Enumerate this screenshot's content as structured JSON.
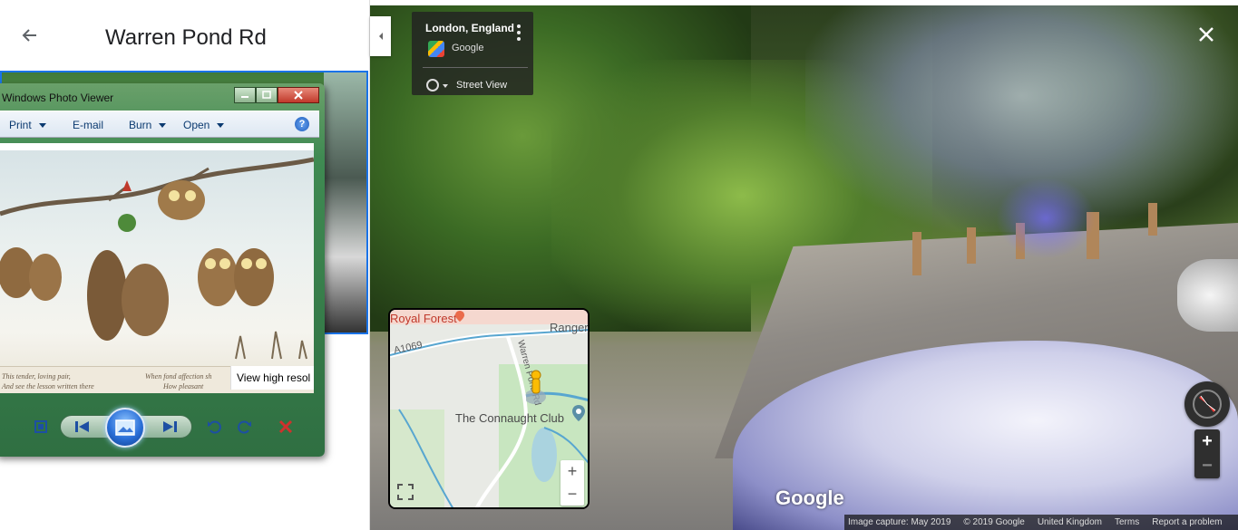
{
  "left_panel": {
    "title": "Warren Pond Rd"
  },
  "photo_viewer": {
    "window_title": "Windows Photo Viewer",
    "menu": {
      "print": "Print",
      "email": "E-mail",
      "burn": "Burn",
      "open": "Open"
    },
    "help": "?",
    "card_lines": [
      "This tender, loving pair,",
      "When fond affection sh",
      "And see the lesson written there",
      "How pleasant"
    ],
    "view_high_res": "View high resol"
  },
  "street_view": {
    "location_title": "London, England",
    "provider": "Google",
    "mode_label": "Street View",
    "google_logo": "Google",
    "footer": {
      "capture": "Image capture: May 2019",
      "copyright": "© 2019 Google",
      "region": "United Kingdom",
      "terms": "Terms",
      "report": "Report a problem"
    }
  },
  "minimap": {
    "labels": {
      "forest": "Royal Forest",
      "ranger": "Ranger",
      "road_a": "A1069",
      "road_b": "Warren Pond Rd",
      "club": "The Connaught Club"
    },
    "zoom_in": "+",
    "zoom_out": "−"
  },
  "controls": {
    "zoom_in": "+",
    "zoom_out": "−"
  },
  "colors": {
    "accent_blue": "#1a73e8",
    "wpv_green": "#3f8a52",
    "map_park": "#c8e6c0",
    "map_water": "#aad3df"
  }
}
